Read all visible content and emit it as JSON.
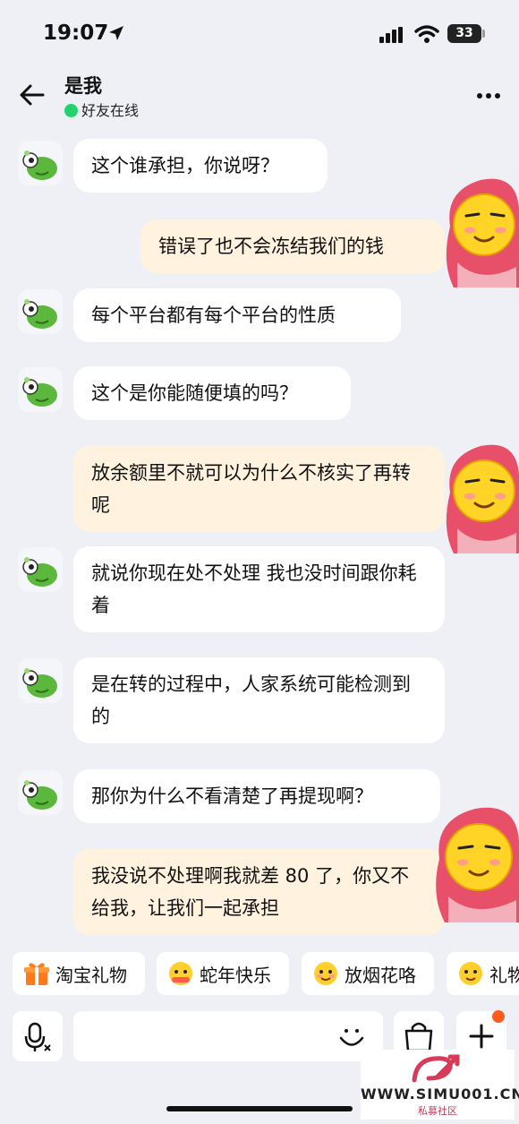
{
  "status_bar": {
    "time": "19:07",
    "battery": "33"
  },
  "header": {
    "title": "是我",
    "status": "好友在线"
  },
  "messages": [
    {
      "side": "in",
      "text": "这个谁承担，你说呀？"
    },
    {
      "side": "out",
      "text": "错误了也不会冻结我们的钱"
    },
    {
      "side": "in",
      "text": "每个平台都有每个平台的性质"
    },
    {
      "side": "in",
      "text": "这个是你能随便填的吗？"
    },
    {
      "side": "out",
      "text": "放余额里不就可以为什么不核实了再转呢"
    },
    {
      "side": "in",
      "text": "就说你现在处不处理 我也没时间跟你耗着"
    },
    {
      "side": "in",
      "text": "是在转的过程中，人家系统可能检测到的"
    },
    {
      "side": "in",
      "text": "那你为什么不看清楚了再提现啊？"
    },
    {
      "side": "out",
      "text": "我没说不处理啊我就差 80 了，你又不给我，让我们一起承担"
    }
  ],
  "quick_replies": [
    {
      "label": "淘宝礼物",
      "icon": "gift-icon"
    },
    {
      "label": "蛇年快乐",
      "icon": "emoji-icon"
    },
    {
      "label": "放烟花咯",
      "icon": "emoji-icon"
    },
    {
      "label": "礼物",
      "icon": "emoji-icon"
    }
  ],
  "input": {
    "placeholder": ""
  },
  "watermark": {
    "site": "WWW.SIMU001.CN",
    "sub": "私募社区"
  },
  "colors": {
    "background": "#eef0f5",
    "incoming_bubble": "#ffffff",
    "outgoing_bubble": "#fff3df",
    "online_dot": "#24d26b",
    "notification_dot": "#ff5a1f"
  }
}
